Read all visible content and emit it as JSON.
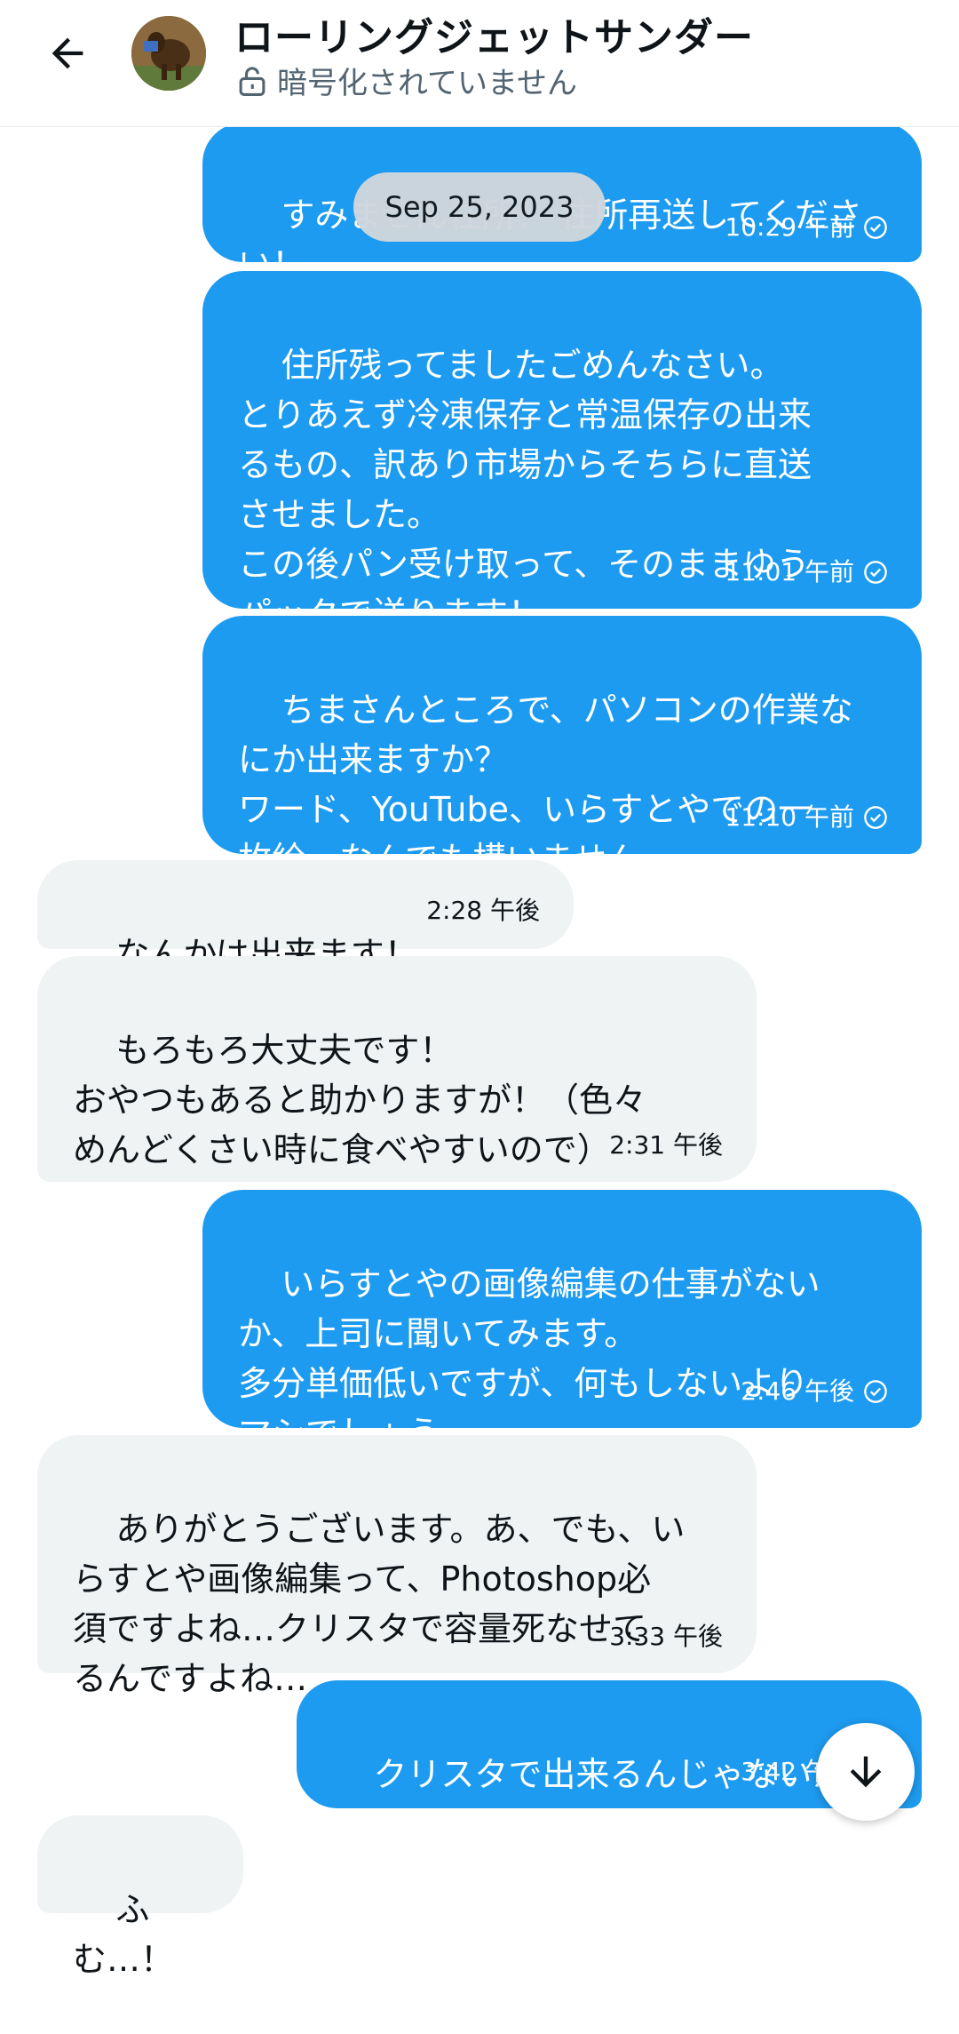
{
  "header": {
    "title": "ローリングジェットサンダー",
    "encryption_status": "暗号化されていません",
    "back_icon": "arrow-left-icon",
    "lock_icon": "unlocked-padlock-icon"
  },
  "date_divider": "Sep 25, 2023",
  "messages": [
    {
      "direction": "out",
      "text": "すみません住所！ 住所再送してくださ\nい！",
      "time": "10:29 午前"
    },
    {
      "direction": "out",
      "text": "住所残ってましたごめんなさい。\nとりあえず冷凍保存と常温保存の出来\nるもの、訳あり市場からそちらに直送\nさせました。\nこの後パン受け取って、そのままゆう\nパックで送ります！",
      "time": "11:01 午前"
    },
    {
      "direction": "out",
      "text": "ちまさんところで、パソコンの作業な\nにか出来ますか？\nワード、YouTube、いらすとやでの一\n枚絵、なんでも構いません",
      "time": "11:10 午前"
    },
    {
      "direction": "in",
      "text": "なんかは出来ます！",
      "time": "2:28 午後"
    },
    {
      "direction": "in",
      "text": "もろもろ大丈夫です！\nおやつもあると助かりますが！（色々\nめんどくさい時に食べやすいので）",
      "time": "2:31 午後"
    },
    {
      "direction": "out",
      "text": "いらすとやの画像編集の仕事がない\nか、上司に聞いてみます。\n多分単価低いですが、何もしないより\nマシでしょう",
      "time": "2:46 午後"
    },
    {
      "direction": "in",
      "text": "ありがとうございます。あ、でも、い\nらすとや画像編集って、Photoshop必\n須ですよね…クリスタで容量死なせて\nるんですよね…",
      "time": "3:33 午後"
    },
    {
      "direction": "out",
      "text": "クリスタで出来るんじゃないかな",
      "time": "3:42 午後"
    },
    {
      "direction": "in",
      "text": "ふむ…！",
      "time": ""
    }
  ],
  "colors": {
    "outgoing_bubble": "#1d9bf0",
    "incoming_bubble": "#eff3f4",
    "secondary_text": "#536471"
  },
  "icons": {
    "read_receipt": "check-circle-icon",
    "scroll_down": "arrow-down-icon"
  }
}
